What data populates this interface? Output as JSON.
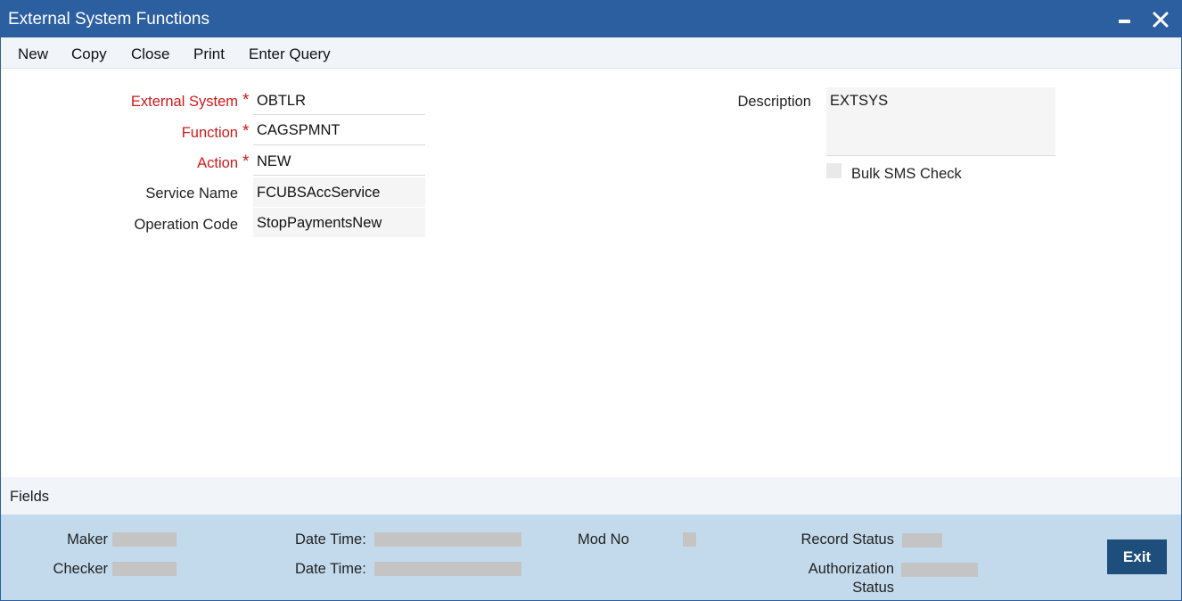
{
  "window": {
    "title": "External System Functions"
  },
  "menu": {
    "new": "New",
    "copy": "Copy",
    "close": "Close",
    "print": "Print",
    "enter_query": "Enter Query"
  },
  "form": {
    "external_system_label": "External System",
    "external_system_value": "OBTLR",
    "function_label": "Function",
    "function_value": "CAGSPMNT",
    "action_label": "Action",
    "action_value": "NEW",
    "service_name_label": "Service Name",
    "service_name_value": "FCUBSAccService",
    "operation_code_label": "Operation Code",
    "operation_code_value": "StopPaymentsNew",
    "required_mark": "*",
    "description_label": "Description",
    "description_value": "EXTSYS",
    "bulk_sms_label": "Bulk SMS Check",
    "bulk_sms_checked": false
  },
  "fields_section": {
    "label": "Fields"
  },
  "footer": {
    "maker_label": "Maker",
    "checker_label": "Checker",
    "date_time_label": "Date Time:",
    "mod_no_label": "Mod No",
    "record_status_label": "Record Status",
    "authorization_label": "Authorization",
    "status_label": "Status",
    "exit_label": "Exit"
  }
}
